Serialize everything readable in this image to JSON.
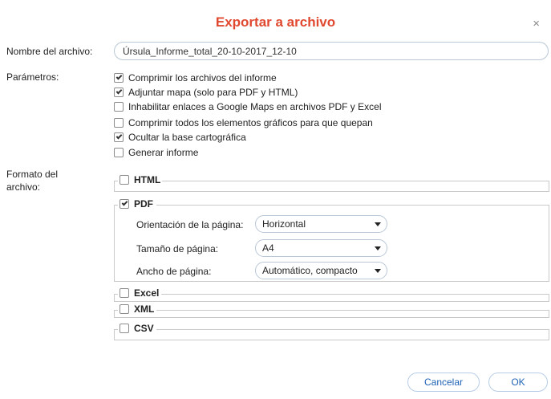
{
  "dialog": {
    "title": "Exportar a archivo",
    "close_glyph": "×"
  },
  "filename": {
    "label": "Nombre del archivo:",
    "value": "Úrsula_Informe_total_20-10-2017_12-10"
  },
  "params": {
    "label": "Parámetros:",
    "items": [
      {
        "label": "Comprimir los archivos del informe",
        "checked": true
      },
      {
        "label": "Adjuntar mapa (solo para PDF y HTML)",
        "checked": true
      },
      {
        "label": "Inhabilitar enlaces a Google Maps en archivos PDF y Excel",
        "checked": false
      },
      {
        "label": "Comprimir todos los elementos gráficos para que quepan",
        "checked": false
      },
      {
        "label": "Ocultar la base cartográfica",
        "checked": true
      },
      {
        "label": "Generar informe",
        "checked": false
      }
    ]
  },
  "format": {
    "label_line1": "Formato del",
    "label_line2": "archivo:",
    "html": {
      "label": "HTML",
      "checked": false
    },
    "pdf": {
      "label": "PDF",
      "checked": true,
      "orientation_label": "Orientación de la página:",
      "orientation_value": "Horizontal",
      "size_label": "Tamaño de página:",
      "size_value": "A4",
      "width_label": "Ancho de página:",
      "width_value": "Automático, compacto"
    },
    "excel": {
      "label": "Excel",
      "checked": false
    },
    "xml": {
      "label": "XML",
      "checked": false
    },
    "csv": {
      "label": "CSV",
      "checked": false
    }
  },
  "buttons": {
    "cancel": "Cancelar",
    "ok": "OK"
  },
  "colors": {
    "title": "#e0492f",
    "button_text": "#1f63b5",
    "input_border": "#b9c7d6"
  },
  "icons": [
    "close-icon",
    "checkbox-icon",
    "chevron-down-icon"
  ]
}
